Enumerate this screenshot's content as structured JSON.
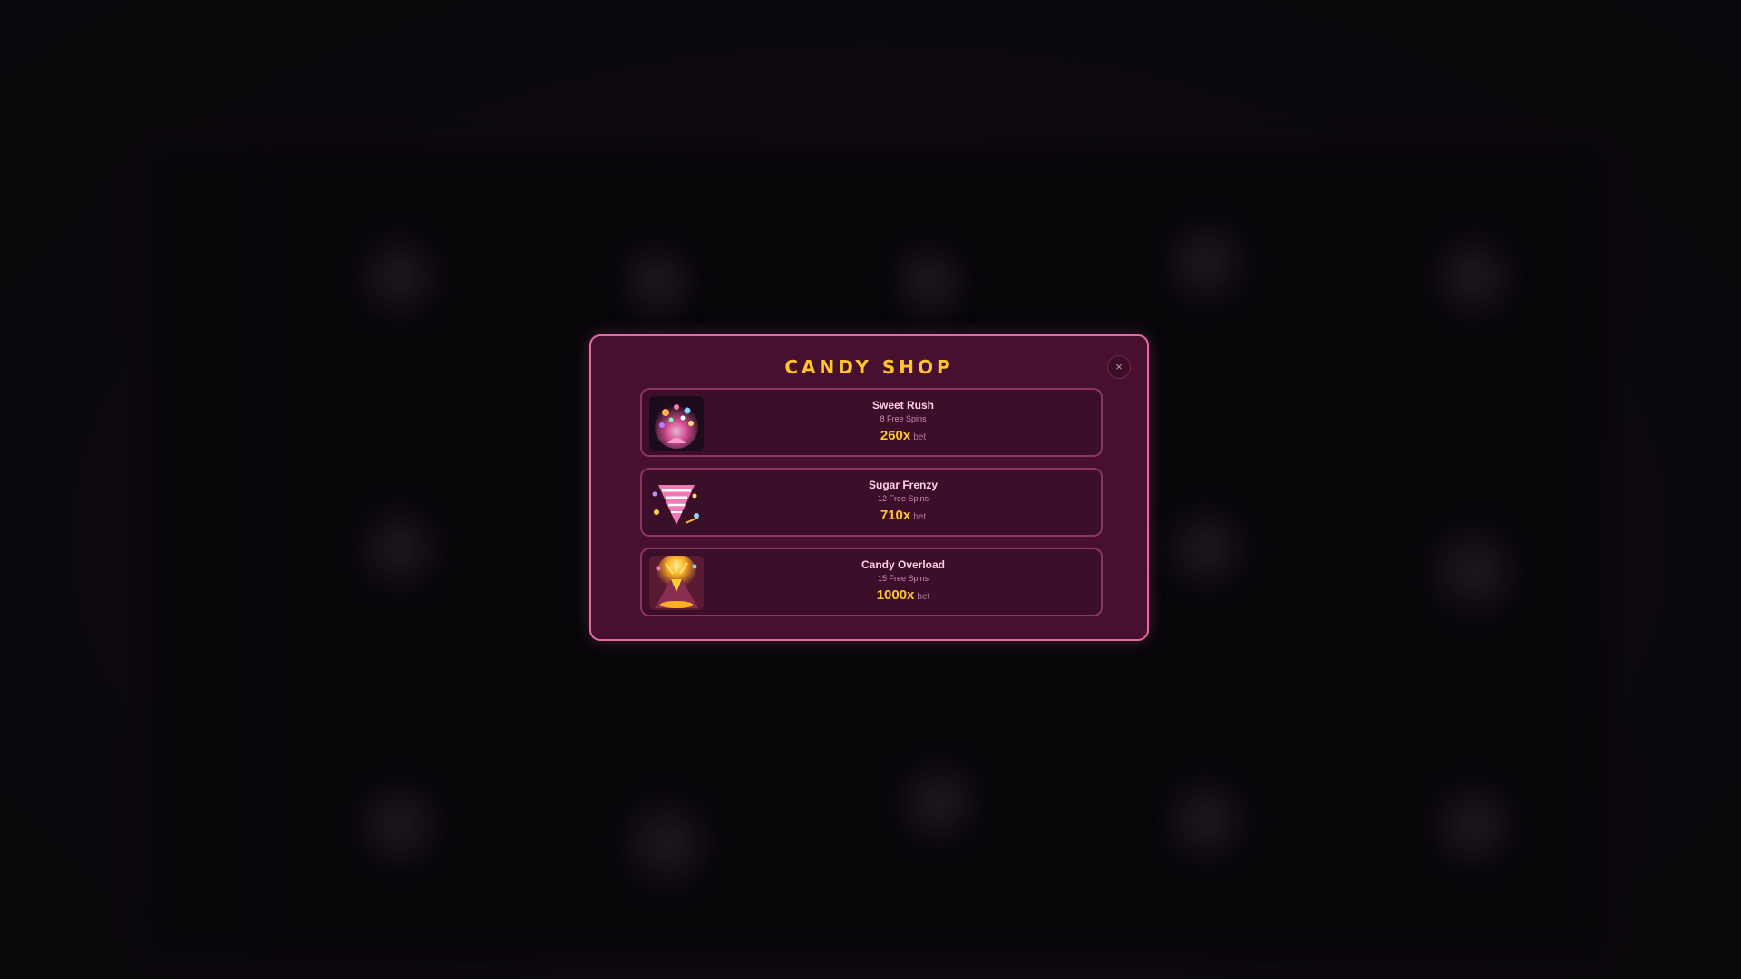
{
  "modal": {
    "title": "CANDY SHOP",
    "close_label": "×"
  },
  "options": [
    {
      "name": "Sweet Rush",
      "spins": "8 Free Spins",
      "multiplier": "260x",
      "bet_label": "bet",
      "icon": "candy-burst-icon"
    },
    {
      "name": "Sugar Frenzy",
      "spins": "12 Free Spins",
      "multiplier": "710x",
      "bet_label": "bet",
      "icon": "candy-tornado-icon"
    },
    {
      "name": "Candy Overload",
      "spins": "15 Free Spins",
      "multiplier": "1000x",
      "bet_label": "bet",
      "icon": "candy-volcano-icon"
    }
  ],
  "colors": {
    "title": "#ffc62b",
    "modal_bg": "#46102e",
    "modal_border": "#e76aa5",
    "option_bg": "#3d0e29",
    "option_border": "#8a3562"
  }
}
